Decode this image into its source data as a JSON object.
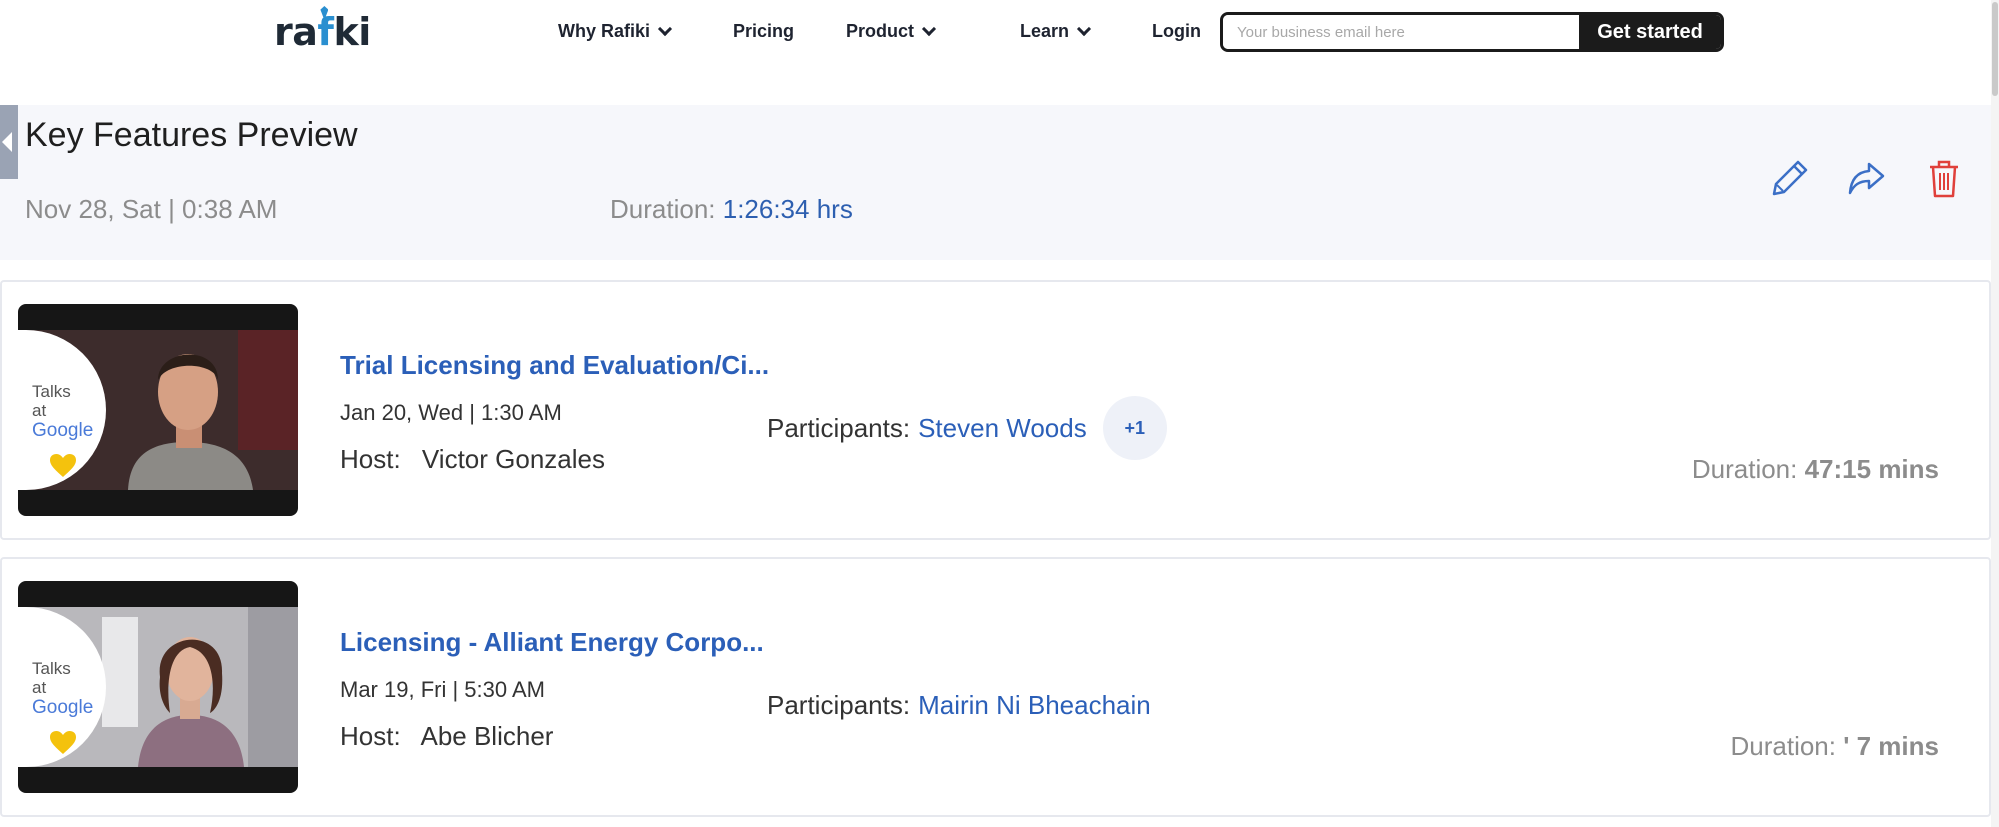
{
  "nav": {
    "logo": "rafiki",
    "items": [
      {
        "label": "Why Rafiki"
      },
      {
        "label": "Pricing"
      },
      {
        "label": "Product"
      },
      {
        "label": "Learn"
      }
    ],
    "login": "Login",
    "email_placeholder": "Your business email here",
    "cta": "Get started"
  },
  "header": {
    "title": "Key Features Preview",
    "date": "Nov 28, Sat | 0:38 AM",
    "duration_label": "Duration:",
    "duration_value": "1:26:34 hrs"
  },
  "calls": [
    {
      "thumb_text": "Talks at",
      "thumb_brand": "Google",
      "title": "Trial Licensing and Evaluation/Ci...",
      "date": "Jan 20, Wed | 1:30 AM",
      "host_label": "Host:",
      "host": "Victor Gonzales",
      "participants_label": "Participants:",
      "participant": "Steven Woods",
      "more": "+1",
      "duration_label": "Duration:",
      "duration_value": "47:15 mins"
    },
    {
      "thumb_text": "Talks at",
      "thumb_brand": "Google",
      "title": "Licensing - Alliant Energy Corpo...",
      "date": "Mar 19, Fri | 5:30 AM",
      "host_label": "Host:",
      "host": "Abe Blicher",
      "participants_label": "Participants:",
      "participant": "Mairin Ni Bheachain",
      "duration_label": "Duration:",
      "duration_value": "' 7 mins"
    }
  ],
  "colors": {
    "link_blue": "#2b5fb8",
    "delete_red": "#e0403b",
    "header_bg": "#f6f7fb"
  }
}
